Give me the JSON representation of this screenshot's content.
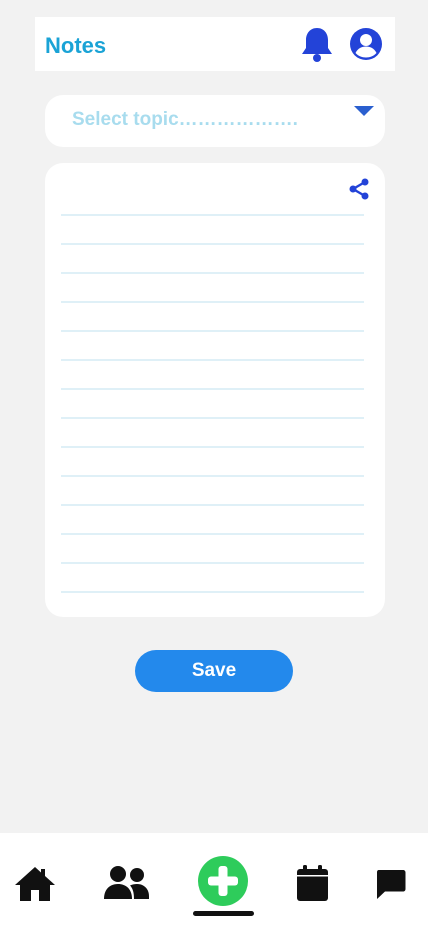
{
  "header": {
    "title": "Notes",
    "bell_icon": "bell-icon",
    "profile_icon": "user-circle-icon"
  },
  "topic_select": {
    "placeholder": "Select topic……………….",
    "caret_icon": "caret-down-icon"
  },
  "note": {
    "share_icon": "share-icon"
  },
  "actions": {
    "save_label": "Save"
  },
  "bottom_nav": {
    "items": [
      {
        "icon": "home-icon"
      },
      {
        "icon": "users-icon"
      },
      {
        "icon": "add-circle-icon",
        "active": true
      },
      {
        "icon": "calendar-icon"
      },
      {
        "icon": "chat-icon"
      }
    ]
  },
  "colors": {
    "background": "#f2f2f2",
    "title": "#1aa3d6",
    "icon_blue": "#2343d8",
    "placeholder": "#a8dcee",
    "save_button": "#2389ec",
    "add_button": "#2ecc5b",
    "note_line": "#dff0f7"
  }
}
